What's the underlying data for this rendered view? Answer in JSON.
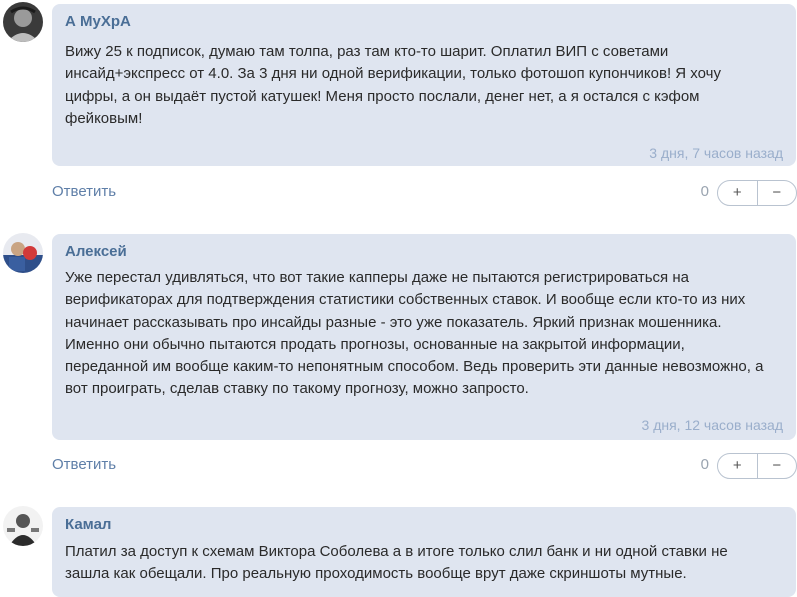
{
  "comments": [
    {
      "author": "А МуХрА",
      "text": [
        "Вижу 25 к подписок, думаю там толпа, раз там кто-то шарит. Оплатил ВИП с советами",
        "инсайд+экспресс от 4.0. За 3 дня ни одной верификации, только фотошоп купончиков! Я хочу",
        "цифры, а он выдаёт пустой катушек! Меня просто послали, денег нет, а я остался с кэфом",
        "фейковым!"
      ],
      "time": "3 дня, 7 часов назад",
      "reply_label": "Ответить",
      "score": "0",
      "plus": "+",
      "minus": "−"
    },
    {
      "author": "Алексей",
      "text": [
        "Уже перестал удивляться, что вот такие капперы даже не пытаются регистрироваться на",
        "верификаторах для подтверждения статистики собственных ставок. И вообще если кто-то из них",
        "начинает рассказывать про инсайды разные - это уже показатель. Яркий признак мошенника.",
        "Именно они обычно пытаются продать прогнозы, основанные на закрытой информации,",
        "переданной им вообще каким-то непонятным способом. Ведь проверить эти данные невозможно, а",
        "вот проиграть, сделав ставку по такому прогнозу, можно запросто."
      ],
      "time": "3 дня, 12 часов назад",
      "reply_label": "Ответить",
      "score": "0",
      "plus": "+",
      "minus": "−"
    },
    {
      "author": "Камал",
      "text": [
        "Платил за доступ к схемам Виктора Соболева а в итоге только слил банк и ни одной ставки не",
        "зашла как обещали. Про реальную проходимость вообще врут даже скриншоты мутные."
      ]
    }
  ]
}
